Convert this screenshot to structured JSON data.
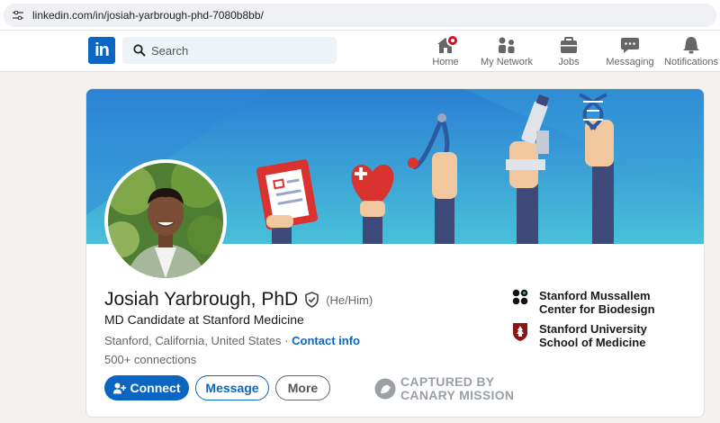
{
  "browser": {
    "url": "linkedin.com/in/josiah-yarbrough-phd-7080b8bb/"
  },
  "nav": {
    "logo": "in",
    "search_placeholder": "Search",
    "items": [
      {
        "label": "Home",
        "icon": "home-icon"
      },
      {
        "label": "My Network",
        "icon": "network-icon"
      },
      {
        "label": "Jobs",
        "icon": "briefcase-icon"
      },
      {
        "label": "Messaging",
        "icon": "chat-icon"
      },
      {
        "label": "Notifications",
        "icon": "bell-icon"
      }
    ]
  },
  "profile": {
    "name": "Josiah Yarbrough, PhD",
    "pronouns": "(He/Him)",
    "headline": "MD Candidate at Stanford Medicine",
    "location": "Stanford, California, United States",
    "separator": "·",
    "contact_link": "Contact info",
    "connections": "500+ connections",
    "buttons": {
      "connect": "Connect",
      "message": "Message",
      "more": "More"
    },
    "organizations": [
      {
        "name": "Stanford Mussallem Center for Biodesign",
        "icon": "biodesign-logo-icon"
      },
      {
        "name": "Stanford University School of Medicine",
        "icon": "stanford-seal-icon"
      }
    ]
  },
  "watermark": {
    "line1": "CAPTURED BY",
    "line2": "CANARY MISSION"
  },
  "colors": {
    "brand": "#0a66c2",
    "badge": "#cb112d",
    "banner_top": "#2b7fd4",
    "banner_bottom": "#49c0d8"
  }
}
